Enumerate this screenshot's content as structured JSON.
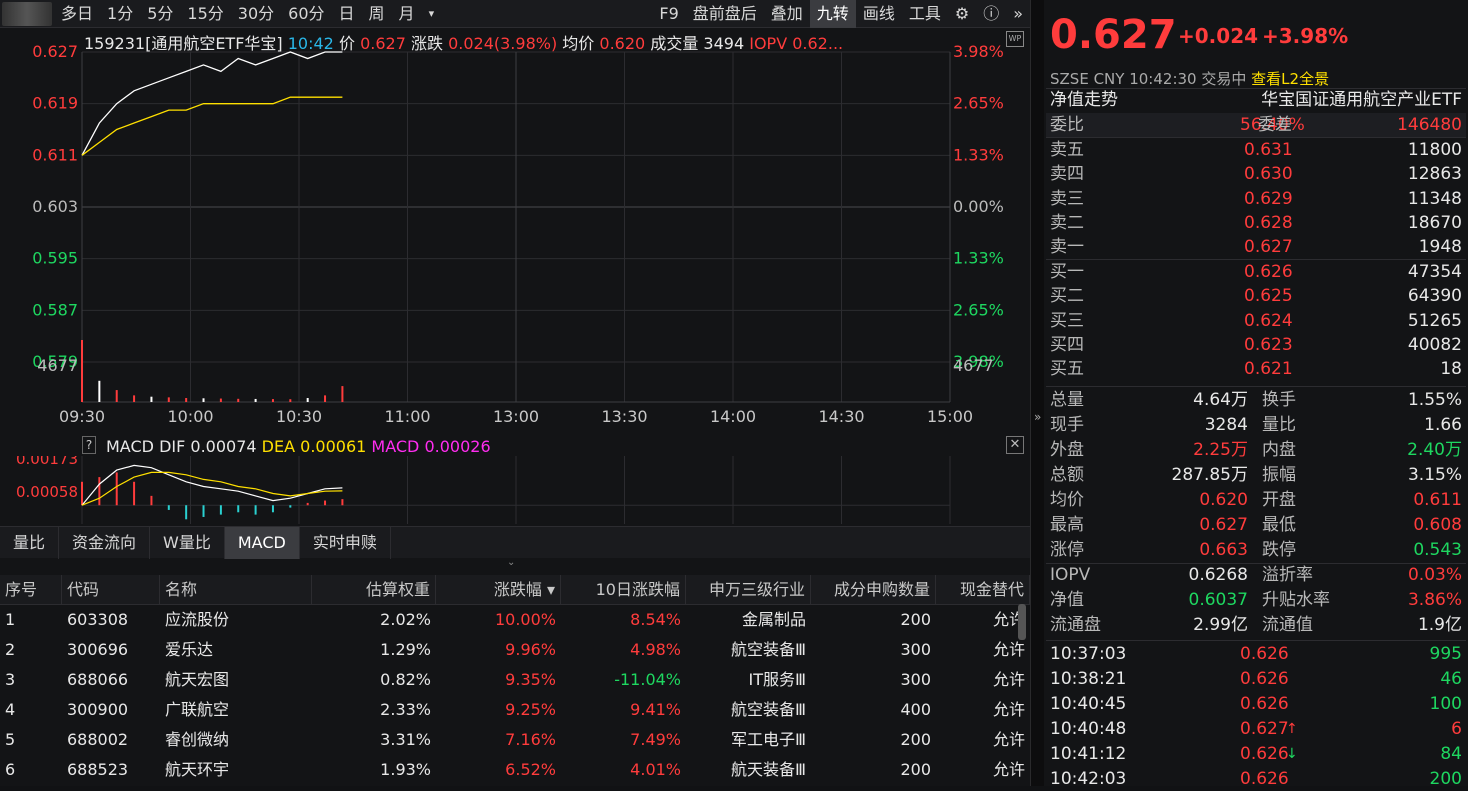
{
  "toolbar": {
    "items": [
      "多日",
      "1分",
      "5分",
      "15分",
      "30分",
      "60分",
      "日",
      "周",
      "月",
      "▾"
    ],
    "right_items": [
      "F9",
      "盘前盘后",
      "叠加",
      "九转",
      "画线",
      "工具"
    ],
    "active": "九转"
  },
  "info": {
    "name": "159231[通用航空ETF华宝]",
    "time": "10:42",
    "price_label": "价",
    "price": "0.627",
    "change_label": "涨跌",
    "change": "0.024(3.98%)",
    "avg_label": "均价",
    "avg": "0.620",
    "vol_label": "成交量",
    "vol": "3494",
    "iopv_label": "IOPV",
    "iopv": "0.62..."
  },
  "chart_data": {
    "type": "line",
    "title": "",
    "y_left_ticks": [
      "0.627",
      "0.619",
      "0.611",
      "0.603",
      "0.595",
      "0.587",
      "0.579"
    ],
    "y_right_ticks": [
      "3.98%",
      "2.65%",
      "1.33%",
      "0.00%",
      "1.33%",
      "2.65%",
      "3.98%"
    ],
    "volume_tick": "4677",
    "x_ticks": [
      "09:30",
      "10:00",
      "10:30",
      "11:00",
      "13:00",
      "13:30",
      "14:00",
      "14:30",
      "15:00"
    ],
    "ylim": [
      0.579,
      0.627
    ],
    "prev_close": 0.603,
    "series": [
      {
        "name": "价",
        "color": "#ffffff",
        "values": [
          0.611,
          0.616,
          0.619,
          0.621,
          0.622,
          0.623,
          0.624,
          0.625,
          0.624,
          0.626,
          0.625,
          0.626,
          0.627,
          0.626,
          0.627,
          0.627
        ]
      },
      {
        "name": "均价",
        "color": "#ffe000",
        "values": [
          0.611,
          0.613,
          0.615,
          0.616,
          0.617,
          0.618,
          0.618,
          0.619,
          0.619,
          0.619,
          0.619,
          0.619,
          0.62,
          0.62,
          0.62,
          0.62
        ]
      }
    ],
    "volume": [
      4677,
      1600,
      900,
      500,
      400,
      350,
      300,
      280,
      260,
      240,
      230,
      220,
      210,
      300,
      500,
      1200
    ]
  },
  "macd": {
    "help": "?",
    "label": "MACD",
    "dif_label": "DIF",
    "dif": "0.00074",
    "dea_label": "DEA",
    "dea": "0.00061",
    "macd_label": "MACD",
    "macd_val": "0.00026",
    "ticks": [
      "0.00173",
      "0.00058"
    ],
    "dif_series": [
      0.0,
      0.0009,
      0.0015,
      0.0017,
      0.0016,
      0.0013,
      0.001,
      0.0008,
      0.0007,
      0.0006,
      0.0004,
      0.0002,
      0.0003,
      0.0005,
      0.0007,
      0.00074
    ],
    "dea_series": [
      0.0,
      0.0003,
      0.0008,
      0.0012,
      0.0014,
      0.0014,
      0.0013,
      0.0011,
      0.001,
      0.0008,
      0.0007,
      0.0005,
      0.0004,
      0.0005,
      0.0006,
      0.00061
    ],
    "hist_series": [
      0.001,
      0.0012,
      0.0014,
      0.001,
      0.0004,
      -0.0002,
      -0.0006,
      -0.0005,
      -0.0004,
      -0.0003,
      -0.0004,
      -0.0003,
      -0.0001,
      0.0001,
      0.0002,
      0.00026
    ]
  },
  "tabs": [
    "量比",
    "资金流向",
    "W量比",
    "MACD",
    "实时申赎"
  ],
  "active_tab": "MACD",
  "table": {
    "headers": [
      "序号",
      "代码",
      "名称",
      "估算权重",
      "涨跌幅 ▾",
      "10日涨跌幅",
      "申万三级行业",
      "成分申购数量",
      "现金替代"
    ],
    "rows": [
      {
        "idx": "1",
        "code": "603308",
        "name": "应流股份",
        "weight": "2.02%",
        "chg": "10.00%",
        "chg10": "8.54%",
        "industry": "金属制品",
        "qty": "200",
        "cash": "允许",
        "chg10_color": "red"
      },
      {
        "idx": "2",
        "code": "300696",
        "name": "爱乐达",
        "weight": "1.29%",
        "chg": "9.96%",
        "chg10": "4.98%",
        "industry": "航空装备Ⅲ",
        "qty": "300",
        "cash": "允许",
        "chg10_color": "red"
      },
      {
        "idx": "3",
        "code": "688066",
        "name": "航天宏图",
        "weight": "0.82%",
        "chg": "9.35%",
        "chg10": "-11.04%",
        "industry": "IT服务Ⅲ",
        "qty": "300",
        "cash": "允许",
        "chg10_color": "green"
      },
      {
        "idx": "4",
        "code": "300900",
        "name": "广联航空",
        "weight": "2.33%",
        "chg": "9.25%",
        "chg10": "9.41%",
        "industry": "航空装备Ⅲ",
        "qty": "400",
        "cash": "允许",
        "chg10_color": "red"
      },
      {
        "idx": "5",
        "code": "688002",
        "name": "睿创微纳",
        "weight": "3.31%",
        "chg": "7.16%",
        "chg10": "7.49%",
        "industry": "军工电子Ⅲ",
        "qty": "200",
        "cash": "允许",
        "chg10_color": "red"
      },
      {
        "idx": "6",
        "code": "688523",
        "name": "航天环宇",
        "weight": "1.93%",
        "chg": "6.52%",
        "chg10": "4.01%",
        "industry": "航天装备Ⅲ",
        "qty": "200",
        "cash": "允许",
        "chg10_color": "red"
      }
    ]
  },
  "quote": {
    "price": "0.627",
    "change": "+0.024",
    "change_pct": "+3.98%",
    "market": "SZSE",
    "currency": "CNY",
    "time": "10:42:30",
    "status": "交易中",
    "l2_link": "查看L2全景",
    "nav_trend": "净值走势",
    "fund_name": "华宝国证通用航空产业ETF",
    "weibi_label": "委比",
    "weibi": "56.40%",
    "weicha_label": "委差",
    "weicha": "146480",
    "asks": [
      {
        "label": "卖五",
        "price": "0.631",
        "vol": "11800"
      },
      {
        "label": "卖四",
        "price": "0.630",
        "vol": "12863"
      },
      {
        "label": "卖三",
        "price": "0.629",
        "vol": "11348"
      },
      {
        "label": "卖二",
        "price": "0.628",
        "vol": "18670"
      },
      {
        "label": "卖一",
        "price": "0.627",
        "vol": "1948"
      }
    ],
    "bids": [
      {
        "label": "买一",
        "price": "0.626",
        "vol": "47354"
      },
      {
        "label": "买二",
        "price": "0.625",
        "vol": "64390"
      },
      {
        "label": "买三",
        "price": "0.624",
        "vol": "51265"
      },
      {
        "label": "买四",
        "price": "0.623",
        "vol": "40082"
      },
      {
        "label": "买五",
        "price": "0.621",
        "vol": "18"
      }
    ],
    "stats": [
      {
        "l1": "总量",
        "v1": "4.64万",
        "c1": "white",
        "l2": "换手",
        "v2": "1.55%",
        "c2": "white"
      },
      {
        "l1": "现手",
        "v1": "3284",
        "c1": "white",
        "l2": "量比",
        "v2": "1.66",
        "c2": "white"
      },
      {
        "l1": "外盘",
        "v1": "2.25万",
        "c1": "red",
        "l2": "内盘",
        "v2": "2.40万",
        "c2": "green"
      },
      {
        "l1": "总额",
        "v1": "287.85万",
        "c1": "white",
        "l2": "振幅",
        "v2": "3.15%",
        "c2": "white"
      },
      {
        "l1": "均价",
        "v1": "0.620",
        "c1": "red",
        "l2": "开盘",
        "v2": "0.611",
        "c2": "red"
      },
      {
        "l1": "最高",
        "v1": "0.627",
        "c1": "red",
        "l2": "最低",
        "v2": "0.608",
        "c2": "red"
      },
      {
        "l1": "涨停",
        "v1": "0.663",
        "c1": "red",
        "l2": "跌停",
        "v2": "0.543",
        "c2": "green"
      }
    ],
    "stats2": [
      {
        "l1": "IOPV",
        "v1": "0.6268",
        "c1": "white",
        "l2": "溢折率",
        "v2": "0.03%",
        "c2": "red"
      },
      {
        "l1": "净值",
        "v1": "0.6037",
        "c1": "green",
        "l2": "升贴水率",
        "v2": "3.86%",
        "c2": "red"
      },
      {
        "l1": "流通盘",
        "v1": "2.99亿",
        "c1": "white",
        "l2": "流通值",
        "v2": "1.9亿",
        "c2": "white"
      }
    ],
    "ticks": [
      {
        "time": "10:37:03",
        "price": "0.626",
        "arrow": "",
        "vol": "995",
        "vc": "green"
      },
      {
        "time": "10:38:21",
        "price": "0.626",
        "arrow": "",
        "vol": "46",
        "vc": "green"
      },
      {
        "time": "10:40:45",
        "price": "0.626",
        "arrow": "",
        "vol": "100",
        "vc": "green"
      },
      {
        "time": "10:40:48",
        "price": "0.627",
        "arrow": "↑",
        "vol": "6",
        "vc": "red"
      },
      {
        "time": "10:41:12",
        "price": "0.626",
        "arrow": "↓",
        "vol": "84",
        "vc": "green"
      },
      {
        "time": "10:42:03",
        "price": "0.626",
        "arrow": "",
        "vol": "200",
        "vc": "green"
      }
    ]
  }
}
